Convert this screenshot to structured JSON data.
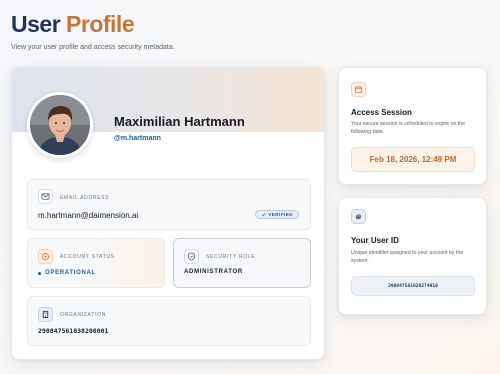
{
  "header": {
    "title_part1": "User",
    "title_part2": "Profile",
    "subtitle": "View your user profile and access security metadata."
  },
  "profile": {
    "name": "Maximilian Hartmann",
    "handle": "@m.hartmann",
    "email": {
      "label": "EMAIL ADDRESS",
      "value": "m.hartmann@daimension.ai",
      "badge": "VERIFIED"
    },
    "account_status": {
      "label": "ACCOUNT STATUS",
      "value": "OPERATIONAL"
    },
    "security_role": {
      "label": "SECURITY ROLE",
      "value": "ADMINISTRATOR"
    },
    "organization": {
      "label": "ORGANIZATION",
      "value": "290847561038200001"
    }
  },
  "session": {
    "title": "Access Session",
    "description": "Your secure session is scheduled to expire on the following date.",
    "expiry": "Feb 18, 2026, 12:49 PM"
  },
  "user_id": {
    "title": "Your User ID",
    "description": "Unique identifier assigned to your account by the system.",
    "value": "290847561028274910"
  },
  "colors": {
    "brand_navy": "#1e3558",
    "brand_orange": "#c4763a",
    "link_blue": "#2a5a93",
    "status_green": "#2a5a93"
  },
  "icons": [
    "mail-icon",
    "status-icon",
    "shield-icon",
    "building-icon",
    "calendar-icon",
    "fingerprint-icon",
    "check-icon"
  ]
}
